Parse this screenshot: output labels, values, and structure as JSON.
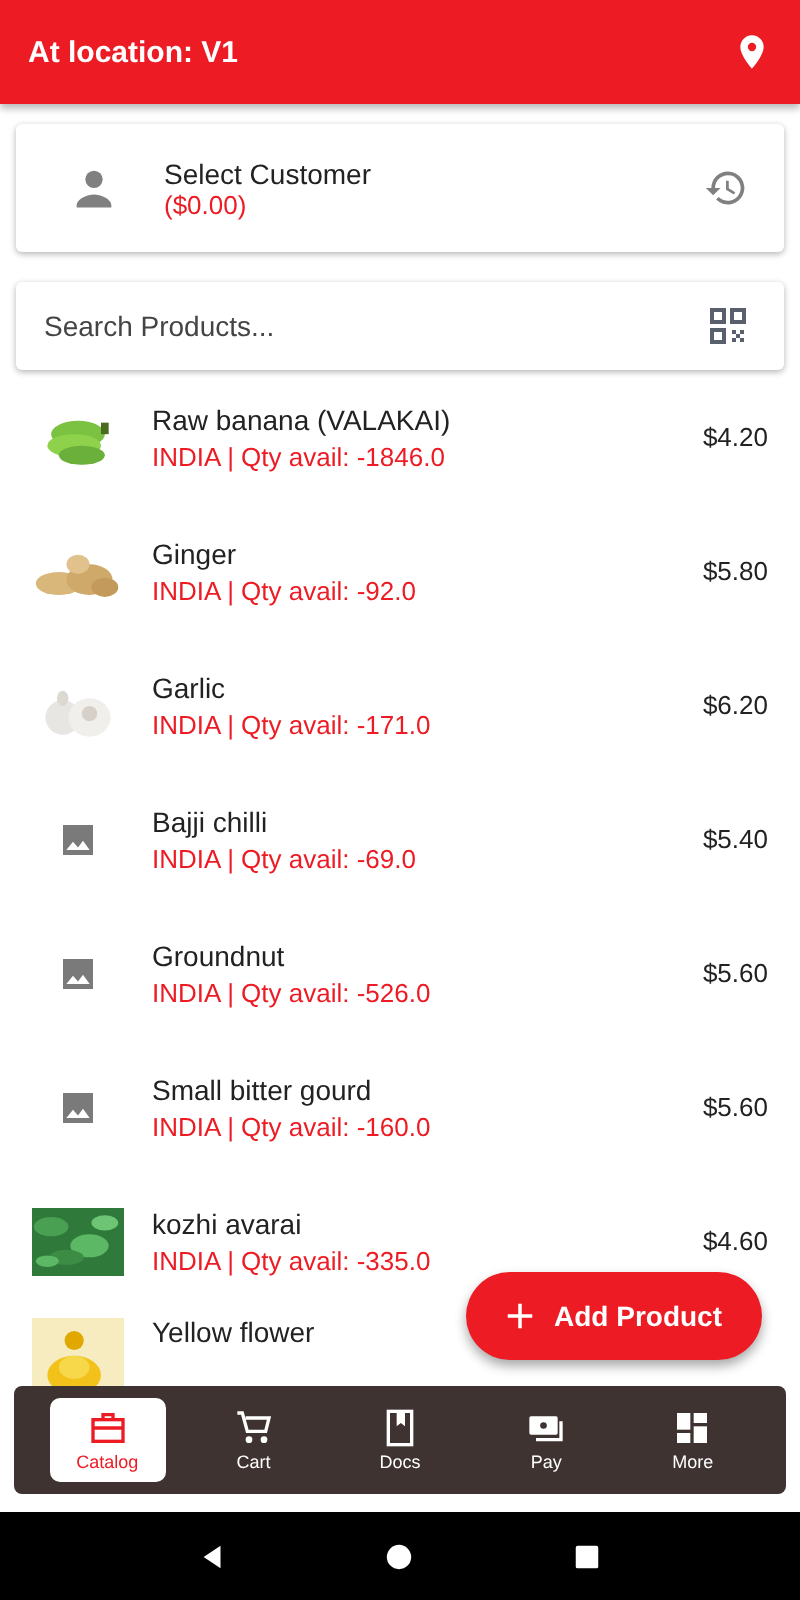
{
  "header": {
    "title": "At location: V1"
  },
  "customer": {
    "name": "Select Customer",
    "balance": "($0.00)"
  },
  "search": {
    "placeholder": "Search Products..."
  },
  "products": [
    {
      "name": "Raw banana (VALAKAI)",
      "detail": "INDIA | Qty avail: -1846.0",
      "price": "$4.20",
      "kind": "picture"
    },
    {
      "name": "Ginger",
      "detail": "INDIA | Qty avail: -92.0",
      "price": "$5.80",
      "kind": "picture"
    },
    {
      "name": "Garlic",
      "detail": "INDIA | Qty avail: -171.0",
      "price": "$6.20",
      "kind": "picture"
    },
    {
      "name": "Bajji chilli",
      "detail": "INDIA | Qty avail: -69.0",
      "price": "$5.40",
      "kind": "placeholder"
    },
    {
      "name": "Groundnut",
      "detail": "INDIA | Qty avail: -526.0",
      "price": "$5.60",
      "kind": "placeholder"
    },
    {
      "name": "Small bitter gourd",
      "detail": "INDIA | Qty avail: -160.0",
      "price": "$5.60",
      "kind": "placeholder"
    },
    {
      "name": "kozhi avarai",
      "detail": "INDIA | Qty avail: -335.0",
      "price": "$4.60",
      "kind": "picture"
    },
    {
      "name": "Yellow flower",
      "kind": "picture"
    }
  ],
  "fab": {
    "label": "Add Product"
  },
  "nav": [
    {
      "label": "Catalog",
      "selected": true
    },
    {
      "label": "Cart",
      "selected": false
    },
    {
      "label": "Docs",
      "selected": false
    },
    {
      "label": "Pay",
      "selected": false
    },
    {
      "label": "More",
      "selected": false
    }
  ]
}
